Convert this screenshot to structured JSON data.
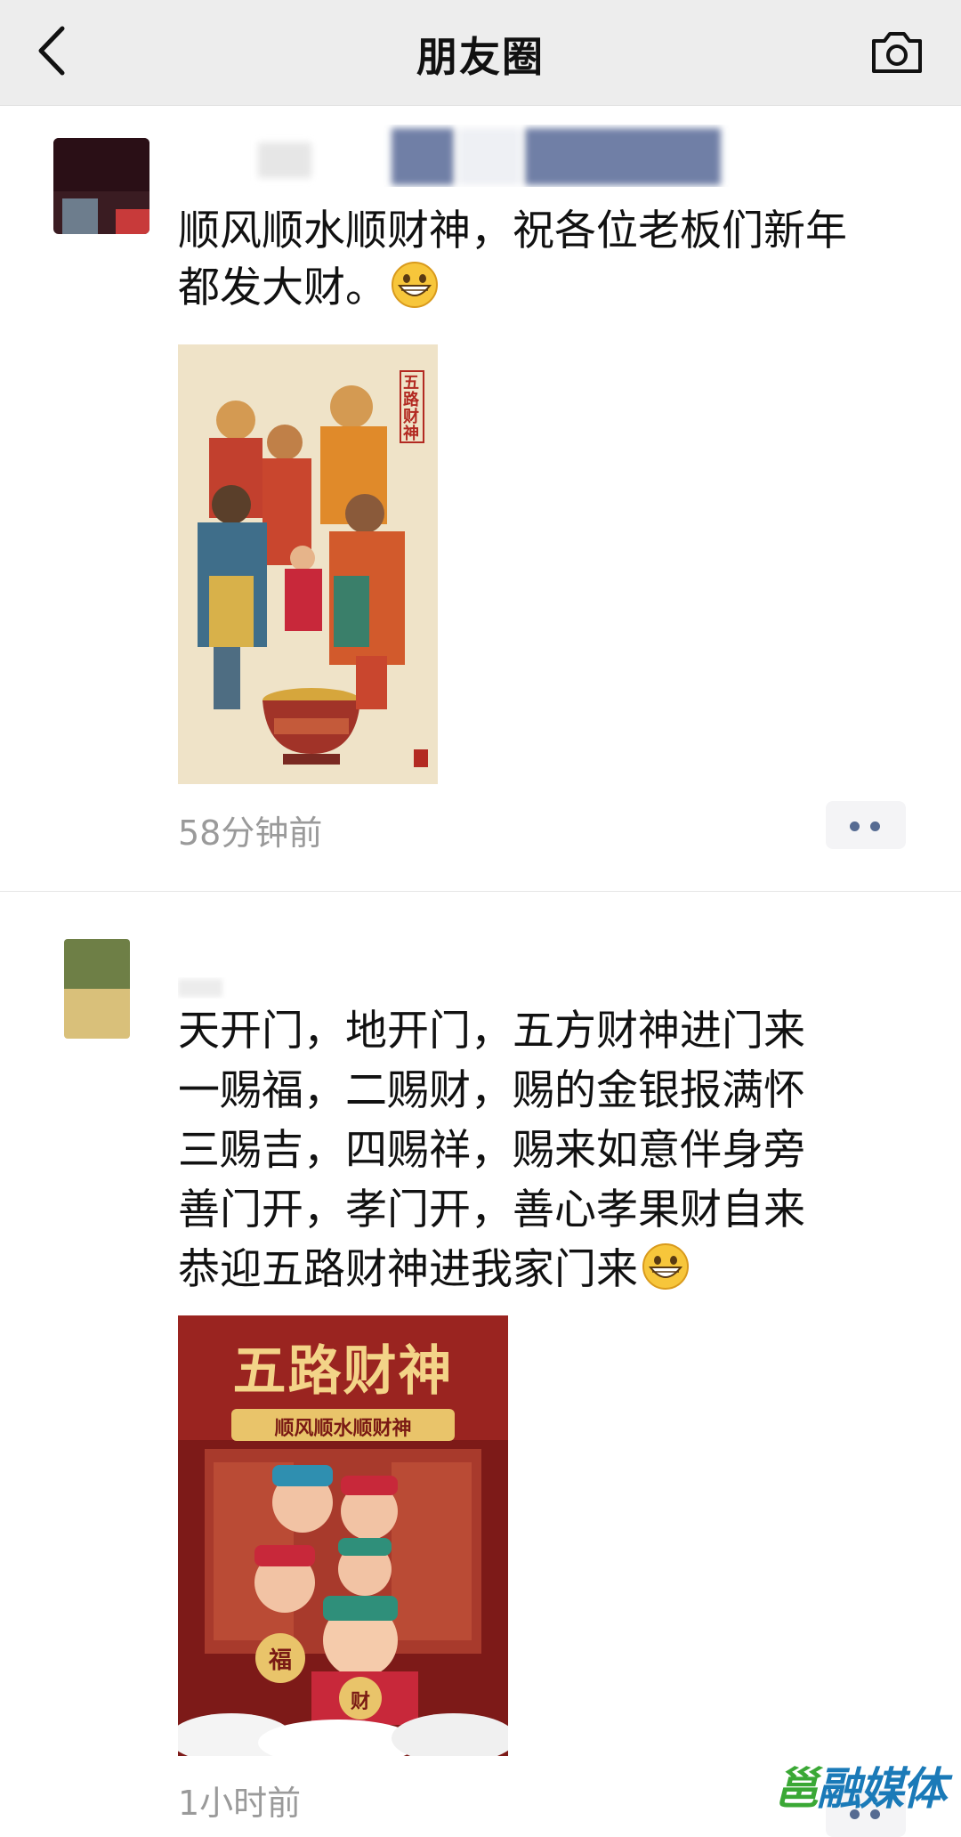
{
  "nav": {
    "title": "朋友圈",
    "back_icon": "back-chevron-icon",
    "camera_icon": "camera-icon"
  },
  "posts": [
    {
      "text": "顺风顺水顺财神，祝各位老板们新年\n都发大财。",
      "emoji": "grinning-face-emoji",
      "image": {
        "description": "traditional painting of five gods of wealth around a treasure bowl",
        "vertical_label": "五路财神"
      },
      "time": "58分钟前",
      "more_icon": "more-dots-icon"
    },
    {
      "text": "天开门，地开门，五方财神进门来\n一赐福，二赐财，赐的金银报满怀\n三赐吉，四赐祥，赐来如意伴身旁\n善门开，孝门开，善心孝果财自来\n恭迎五路财神进我家门来",
      "emoji": "grinning-face-emoji",
      "image": {
        "description": "cartoon 3D poster of five gods of wealth",
        "title": "五路财神",
        "subtitle": "顺风顺水顺财神",
        "badge_left": "福",
        "badge_right": "财"
      },
      "time": "1小时前",
      "more_icon": "more-dots-icon"
    }
  ],
  "watermark": {
    "text_a": "邕",
    "text_b": "融媒体"
  },
  "colors": {
    "navbar_bg": "#ededed",
    "link_blue": "#566b92",
    "time_gray": "#9a9a9a"
  }
}
